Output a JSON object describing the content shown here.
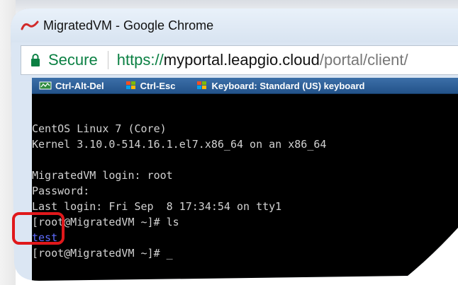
{
  "window": {
    "title": "MigratedVM - Google Chrome"
  },
  "address_bar": {
    "secure_label": "Secure",
    "url_scheme": "https://",
    "url_host": "myportal.leapgio.cloud",
    "url_path": "/portal/client/"
  },
  "console_toolbar": {
    "items": [
      {
        "label": "Ctrl-Alt-Del",
        "icon": "keyboard-icon"
      },
      {
        "label": "Ctrl-Esc",
        "icon": "windows-logo-icon"
      },
      {
        "label": "Keyboard: Standard (US) keyboard",
        "icon": "windows-logo-icon"
      }
    ]
  },
  "terminal": {
    "lines": [
      "CentOS Linux 7 (Core)",
      "Kernel 3.10.0-514.16.1.el7.x86_64 on an x86_64",
      "",
      "MigratedVM login: root",
      "Password:",
      "Last login: Fri Sep  8 17:34:54 on tty1",
      "[root@MigratedVM ~]# ls",
      "test",
      "[root@MigratedVM ~]# _"
    ],
    "highlighted_output": "test"
  },
  "annotation": {
    "color": "#e0181b"
  }
}
